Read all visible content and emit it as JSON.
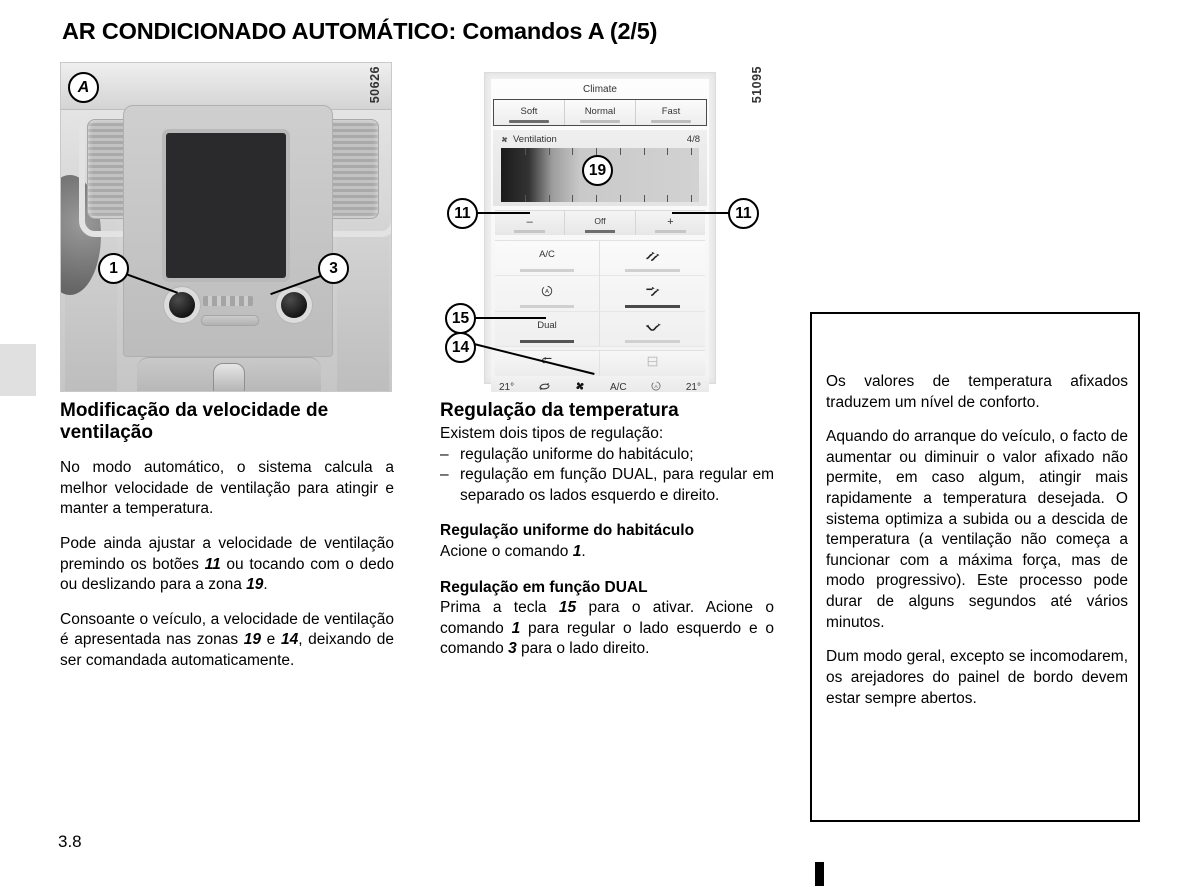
{
  "page": {
    "title": "AR CONDICIONADO AUTOMÁTICO: Comandos A (2/5)",
    "number": "3.8"
  },
  "figures": [
    {
      "id": "fig-a",
      "ref": "50626",
      "marker": "A",
      "callouts": [
        {
          "label": "1"
        },
        {
          "label": "3"
        }
      ]
    },
    {
      "id": "fig-b",
      "ref": "51095",
      "callouts": [
        {
          "label": "19"
        },
        {
          "label": "11"
        },
        {
          "label": "11"
        },
        {
          "label": "15"
        },
        {
          "label": "14"
        }
      ]
    }
  ],
  "climate_screen": {
    "title": "Climate",
    "modes": [
      {
        "label": "Soft",
        "active": true
      },
      {
        "label": "Normal",
        "active": false
      },
      {
        "label": "Fast",
        "active": false
      }
    ],
    "ventilation": {
      "icon": "fan-icon",
      "label": "Ventilation",
      "level": "4/8"
    },
    "minus_label": "–",
    "off_label": "Off",
    "plus_label": "+",
    "buttons": [
      {
        "label": "A/C",
        "icon": "",
        "on": false
      },
      {
        "label": "",
        "icon": "air-flow-face-icon",
        "on": false
      },
      {
        "label": "",
        "icon": "auto-recirc-icon",
        "on": false
      },
      {
        "label": "",
        "icon": "air-flow-face-feet-icon",
        "on": true
      },
      {
        "label": "Dual",
        "icon": "",
        "on": true
      },
      {
        "label": "",
        "icon": "air-flow-feet-icon",
        "on": false
      }
    ],
    "nav": [
      {
        "icon": "back-arrow-icon"
      },
      {
        "icon": "menu-grid-icon"
      }
    ],
    "bottom_bar": {
      "temp_left": "21°",
      "recirc_icon": "recirculation-icon",
      "fan_icon": "fan-icon",
      "ac_label": "A/C",
      "auto_icon": "auto-icon",
      "temp_right": "21°"
    }
  },
  "columns": {
    "col1": {
      "heading": "Modificação da velocidade de ventilação",
      "p1": "No modo automático, o sistema calcula a melhor velocidade de ventilação para atingir e manter a temperatura.",
      "p2_a": "Pode ainda ajustar a velocidade de ventilação premindo os botões ",
      "p2_ref1": "11",
      "p2_b": " ou tocando com o dedo ou deslizando para a zona ",
      "p2_ref2": "19",
      "p2_c": ".",
      "p3_a": "Consoante o veículo, a velocidade de ventilação é apresentada nas zonas ",
      "p3_ref1": "19",
      "p3_b": " e ",
      "p3_ref2": "14",
      "p3_c": ", deixando de ser comandada automaticamente."
    },
    "col2": {
      "heading": "Regulação da temperatura",
      "intro": "Existem dois tipos de regulação:",
      "bullet1": "regulação uniforme do habitáculo;",
      "bullet2": "regulação em função DUAL, para regular em separado os lados esquerdo e direito.",
      "sub1": "Regulação uniforme do habitáculo",
      "sub1_a": "Acione o comando ",
      "sub1_ref": "1",
      "sub1_b": ".",
      "sub2": "Regulação em função DUAL",
      "sub2_a": "Prima a tecla ",
      "sub2_ref1": "15",
      "sub2_b": " para o ativar. Acione o comando ",
      "sub2_ref2": "1",
      "sub2_c": " para regular o lado esquerdo e o comando ",
      "sub2_ref3": "3",
      "sub2_d": " para o lado direito."
    },
    "col3": {
      "p1": "Os valores de temperatura afixados traduzem um nível de conforto.",
      "p2": "Aquando do arranque do veículo, o facto de aumentar ou diminuir o valor afixado não permite, em caso algum, atingir mais rapidamente a temperatura desejada. O sistema optimiza a subida ou a descida de temperatura (a ventilação não começa a funcionar com a máxima força, mas de modo progressivo). Este processo pode durar de alguns segundos até vários minutos.",
      "p3": "Dum modo geral, excepto se incomodarem, os arejadores do painel de bordo devem estar sempre abertos."
    }
  }
}
